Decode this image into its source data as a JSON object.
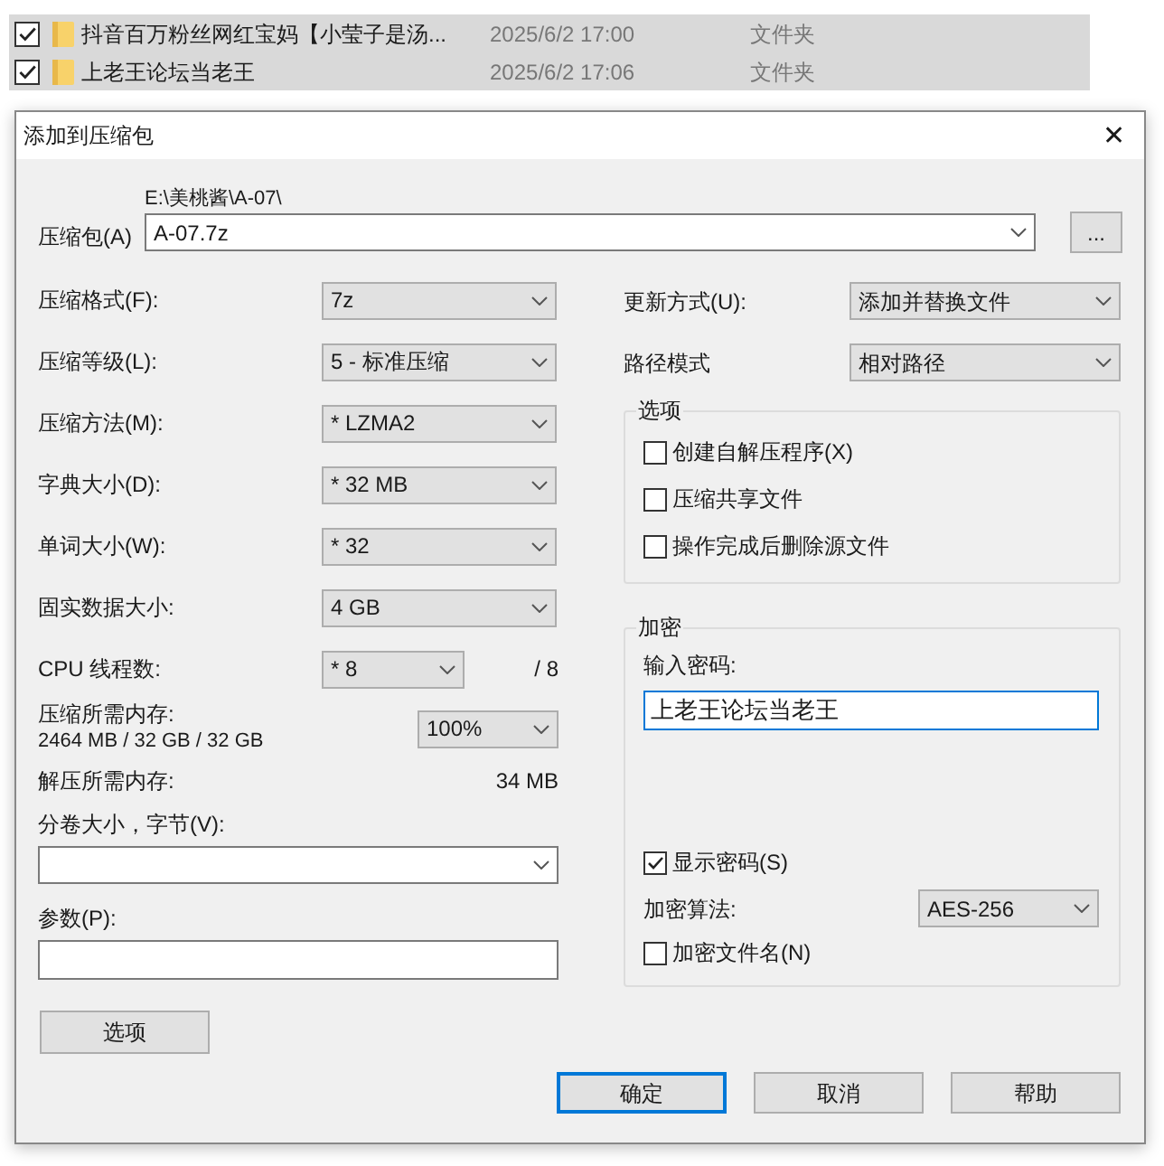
{
  "files": [
    {
      "name": "抖音百万粉丝网红宝妈【小莹子是汤...",
      "date": "2025/6/2 17:00",
      "type": "文件夹",
      "checked": true
    },
    {
      "name": "上老王论坛当老王",
      "date": "2025/6/2 17:06",
      "type": "文件夹",
      "checked": true
    }
  ],
  "dialog": {
    "title": "添加到压缩包",
    "close": "✕",
    "archive": {
      "label": "压缩包(A)",
      "path": "E:\\美桃酱\\A-07\\",
      "value": "A-07.7z",
      "browse": "..."
    },
    "left": [
      {
        "kind": "select",
        "label": "压缩格式(F):",
        "value": "7z"
      },
      {
        "kind": "select",
        "label": "压缩等级(L):",
        "value": "5 - 标准压缩"
      },
      {
        "kind": "select",
        "label": "压缩方法(M):",
        "value": "* LZMA2"
      },
      {
        "kind": "select",
        "label": "字典大小(D):",
        "value": "* 32 MB"
      },
      {
        "kind": "select",
        "label": "单词大小(W):",
        "value": "* 32"
      },
      {
        "kind": "select",
        "label": "固实数据大小:",
        "value": "4 GB"
      },
      {
        "kind": "threads",
        "label": "CPU 线程数:",
        "value": "* 8",
        "suffix": "/ 8"
      },
      {
        "kind": "memory",
        "label": "压缩所需内存:",
        "detail": "2464 MB / 32 GB / 32 GB",
        "value": "100%"
      },
      {
        "kind": "info",
        "label": "解压所需内存:",
        "value": "34 MB"
      }
    ],
    "volume": {
      "label": "分卷大小，字节(V):"
    },
    "params": {
      "label": "参数(P):"
    },
    "update": {
      "label": "更新方式(U):",
      "value": "添加并替换文件"
    },
    "path_mode": {
      "label": "路径模式",
      "value": "相对路径"
    },
    "options": {
      "title": "选项",
      "items": [
        {
          "label": "创建自解压程序(X)",
          "checked": false
        },
        {
          "label": "压缩共享文件",
          "checked": false
        },
        {
          "label": "操作完成后删除源文件",
          "checked": false
        }
      ]
    },
    "encryption": {
      "title": "加密",
      "password_label": "输入密码:",
      "password_value": "上老王论坛当老王",
      "show_password": {
        "label": "显示密码(S)",
        "checked": true
      },
      "method": {
        "label": "加密算法:",
        "value": "AES-256"
      },
      "encrypt_names": {
        "label": "加密文件名(N)",
        "checked": false
      }
    },
    "options_button": "选项",
    "buttons": [
      {
        "label": "确定",
        "default": true
      },
      {
        "label": "取消",
        "default": false
      },
      {
        "label": "帮助",
        "default": false
      }
    ]
  }
}
